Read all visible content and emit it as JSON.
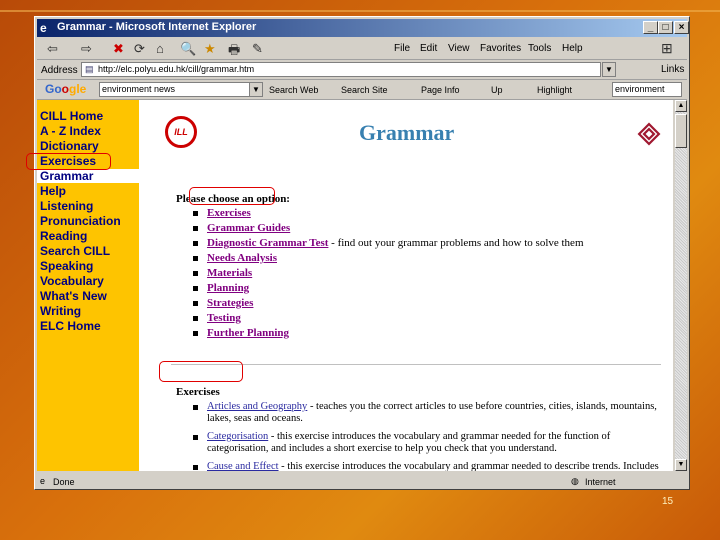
{
  "window": {
    "title": "Grammar - Microsoft Internet Explorer"
  },
  "window_controls": {
    "minimize": "_",
    "maximize": "□",
    "close": "×"
  },
  "toolbar": {
    "back": "⇦",
    "forward": "⇨",
    "stop": "✖",
    "refresh": "⟳",
    "home": "⌂",
    "search": "🔍",
    "favorites": "★",
    "print": "🖶",
    "edit": "✎",
    "menu": [
      "File",
      "Edit",
      "View",
      "Favorites",
      "Tools",
      "Help"
    ]
  },
  "address_bar": {
    "label": "Address",
    "url": "http://elc.polyu.edu.hk/cill/grammar.htm",
    "links": "Links"
  },
  "google_bar": {
    "logo": [
      "Go",
      "o",
      "gle"
    ],
    "query": "environment news",
    "search_web": "Search Web",
    "search_site": "Search Site",
    "page_info": "Page Info",
    "up": "Up",
    "highlight": "Highlight",
    "term": "environment"
  },
  "sidebar": {
    "items": [
      {
        "label": "CILL Home"
      },
      {
        "label": "A - Z Index"
      },
      {
        "label": "Dictionary"
      },
      {
        "label": "Exercises"
      },
      {
        "label": "Grammar"
      },
      {
        "label": "Help"
      },
      {
        "label": "Listening"
      },
      {
        "label": "Pronunciation"
      },
      {
        "label": "Reading"
      },
      {
        "label": "Search CILL"
      },
      {
        "label": "Speaking"
      },
      {
        "label": "Vocabulary"
      },
      {
        "label": "What's New"
      },
      {
        "label": "Writing"
      },
      {
        "label": "ELC Home"
      }
    ]
  },
  "page": {
    "logo_text": "ILL",
    "title": "Grammar",
    "choose": "Please choose an option:",
    "options": [
      {
        "link": "Exercises",
        "desc": ""
      },
      {
        "link": "Grammar Guides",
        "desc": ""
      },
      {
        "link": "Diagnostic Grammar Test",
        "desc": " - find out your grammar problems and how to solve them"
      },
      {
        "link": "Needs Analysis",
        "desc": ""
      },
      {
        "link": "Materials",
        "desc": ""
      },
      {
        "link": "Planning",
        "desc": ""
      },
      {
        "link": "Strategies",
        "desc": ""
      },
      {
        "link": "Testing",
        "desc": ""
      },
      {
        "link": "Further Planning",
        "desc": ""
      }
    ],
    "section_title": "Exercises",
    "exercises": [
      {
        "link": "Articles and Geography",
        "desc": " - teaches you the correct articles to use before countries, cities, islands, mountains, lakes, seas and oceans."
      },
      {
        "link": "Categorisation",
        "desc": " - this exercise introduces the vocabulary and grammar needed for the function of categorisation, and includes a short exercise to help you check that you understand."
      },
      {
        "link": "Cause and Effect",
        "desc": " - this exercise introduces the vocabulary and grammar needed to describe trends. Includes an exercise."
      }
    ]
  },
  "status": {
    "text": "Done",
    "zone": "Internet"
  },
  "slide_number": "15"
}
